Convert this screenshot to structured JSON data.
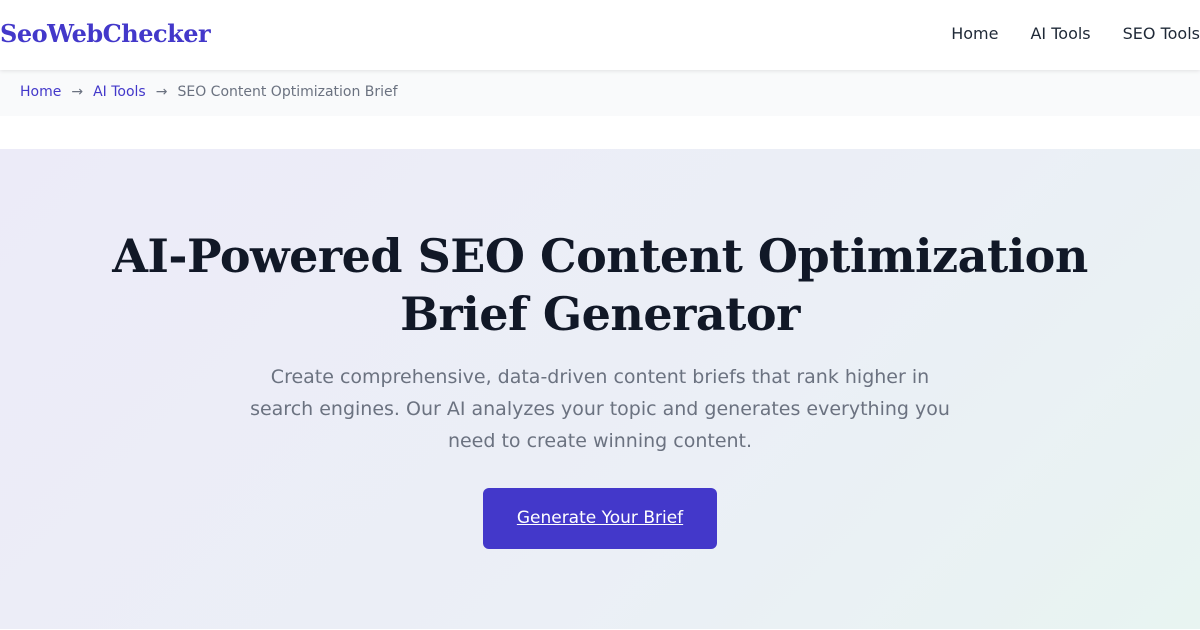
{
  "header": {
    "logo": "SeoWebChecker",
    "nav": [
      "Home",
      "AI Tools",
      "SEO Tools"
    ]
  },
  "breadcrumb": {
    "items": [
      "Home",
      "AI Tools",
      "SEO Content Optimization Brief"
    ],
    "separator": "→"
  },
  "hero": {
    "title": "AI-Powered SEO Content Optimization Brief Generator",
    "description": "Create comprehensive, data-driven content briefs that rank higher in search engines. Our AI analyzes your topic and generates everything you need to create winning content.",
    "cta_label": "Generate Your Brief"
  },
  "colors": {
    "brand": "#4338ca",
    "text": "#111827",
    "muted": "#6b7280"
  }
}
